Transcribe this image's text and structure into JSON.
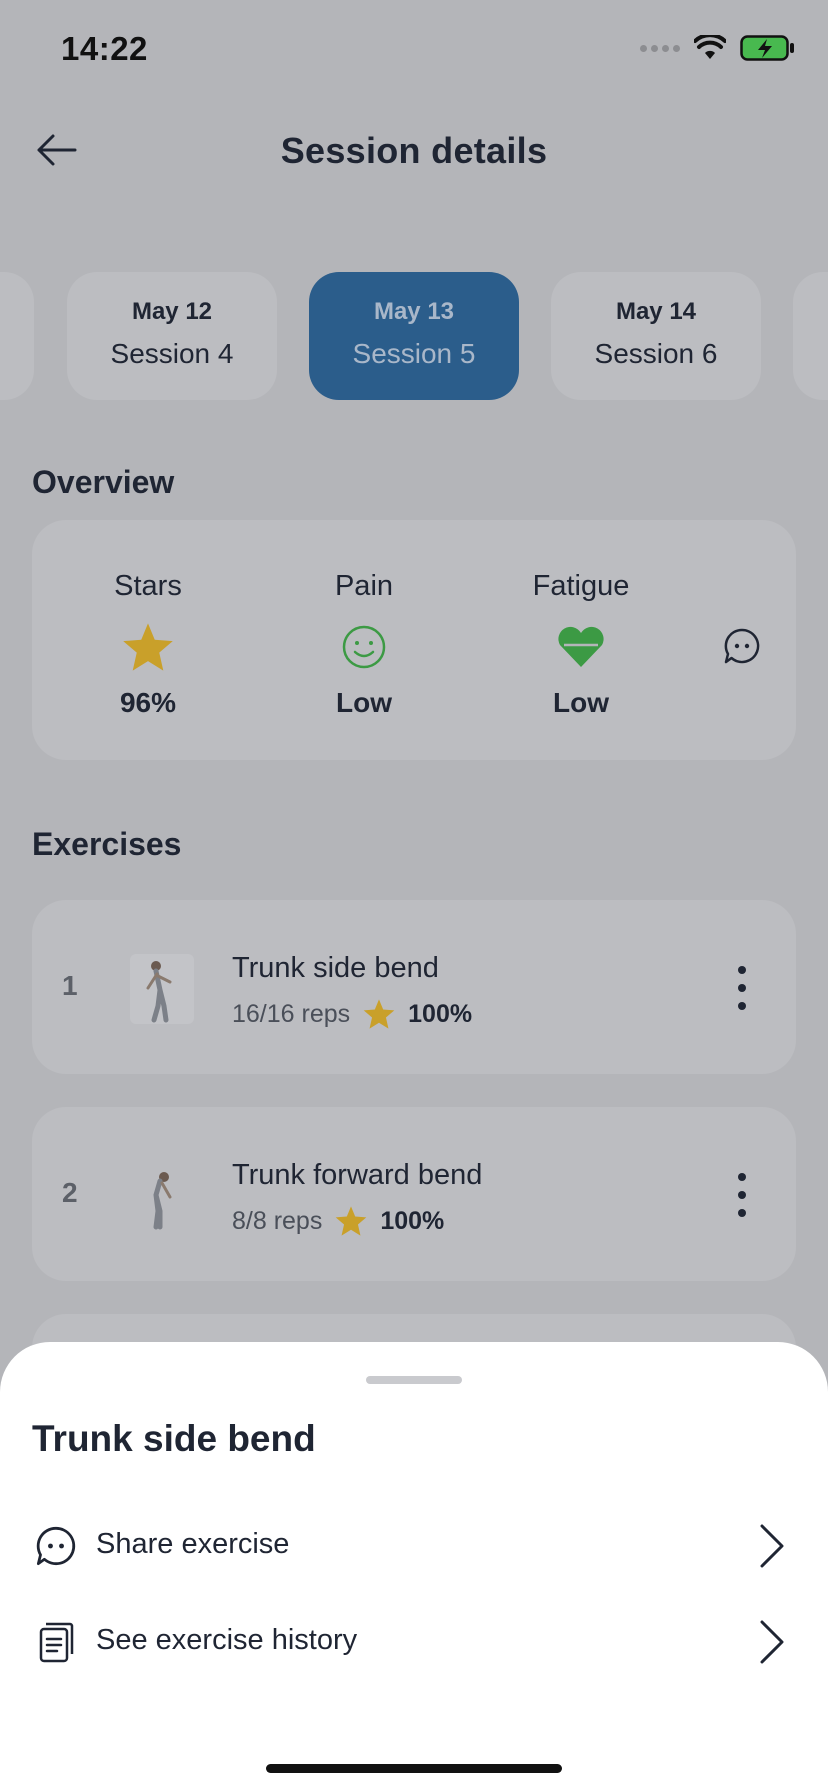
{
  "status_bar": {
    "time": "14:22"
  },
  "header": {
    "title": "Session details"
  },
  "sessions": [
    {
      "date": "May 12",
      "label": "Session 4",
      "active": false
    },
    {
      "date": "May 13",
      "label": "Session 5",
      "active": true
    },
    {
      "date": "May 14",
      "label": "Session 6",
      "active": false
    }
  ],
  "overview": {
    "title": "Overview",
    "stars": {
      "label": "Stars",
      "value": "96%",
      "icon": "star-icon"
    },
    "pain": {
      "label": "Pain",
      "value": "Low",
      "icon": "smiley-icon"
    },
    "fatigue": {
      "label": "Fatigue",
      "value": "Low",
      "icon": "heart-icon"
    }
  },
  "exercises": {
    "title": "Exercises",
    "items": [
      {
        "index": "1",
        "name": "Trunk side bend",
        "reps": "16/16 reps",
        "score": "100%"
      },
      {
        "index": "2",
        "name": "Trunk forward bend",
        "reps": "8/8 reps",
        "score": "100%"
      }
    ]
  },
  "sheet": {
    "title": "Trunk side bend",
    "actions": [
      {
        "label": "Share exercise",
        "icon": "chat-bubble-icon"
      },
      {
        "label": "See exercise history",
        "icon": "document-icon"
      }
    ]
  },
  "colors": {
    "accent": "#2B5D8B",
    "star": "#C9A02A",
    "positive": "#3C9A44"
  }
}
